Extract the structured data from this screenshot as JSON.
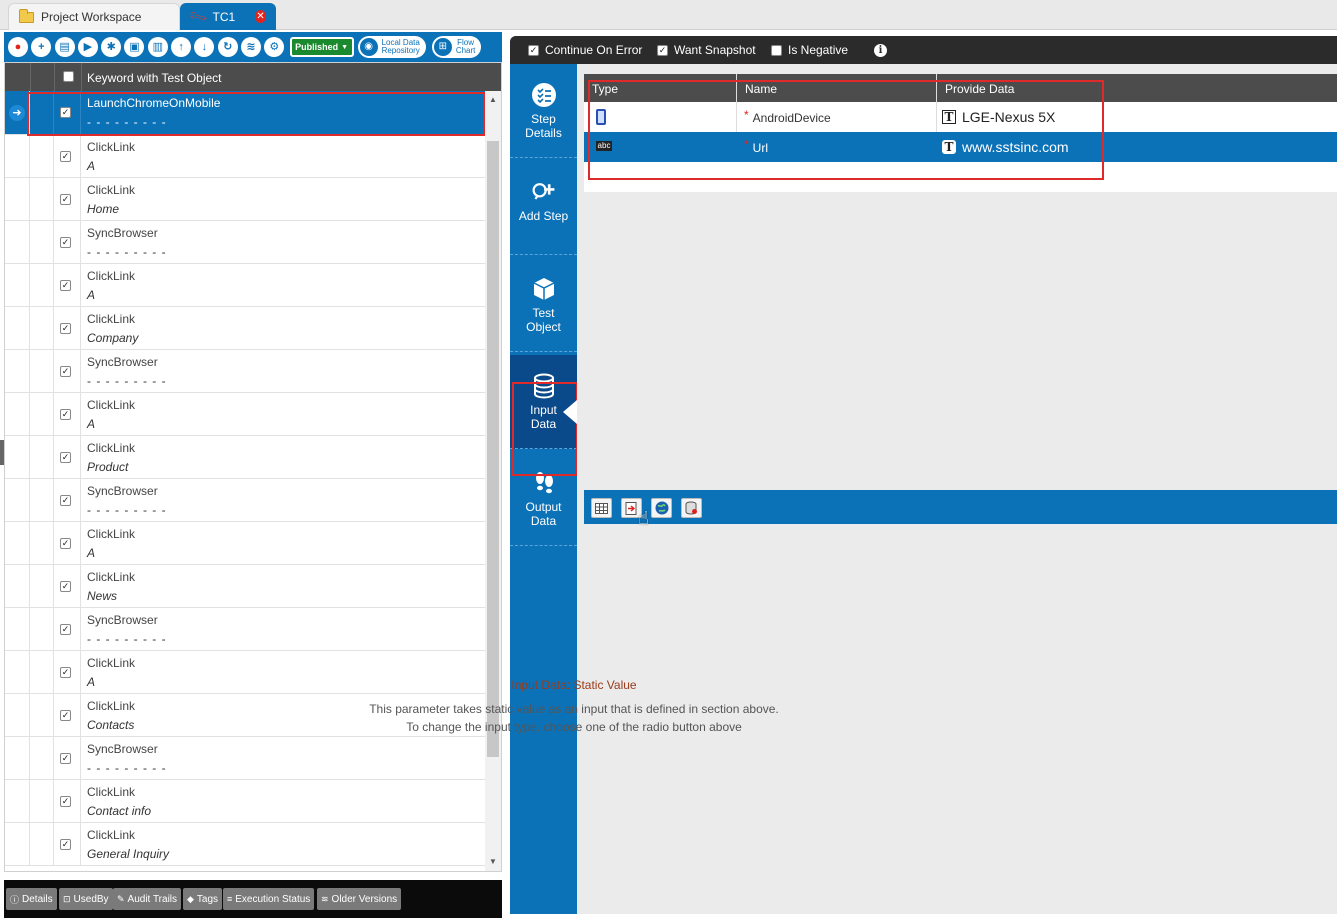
{
  "tabs": {
    "workspace": "Project Workspace",
    "testcase": "TC1"
  },
  "toolbar": {
    "published": "Published",
    "local_repo_line1": "Local Data",
    "local_repo_line2": "Repository",
    "flow_chart_line1": "Flow",
    "flow_chart_line2": "Chart"
  },
  "grid": {
    "header": "Keyword with Test Object",
    "rows": [
      {
        "keyword": "LaunchChromeOnMobile",
        "object": "- - - - - - - - -"
      },
      {
        "keyword": "ClickLink",
        "object": "A"
      },
      {
        "keyword": "ClickLink",
        "object": "Home"
      },
      {
        "keyword": "SyncBrowser",
        "object": "- - - - - - - - -"
      },
      {
        "keyword": "ClickLink",
        "object": "A"
      },
      {
        "keyword": "ClickLink",
        "object": "Company"
      },
      {
        "keyword": "SyncBrowser",
        "object": "- - - - - - - - -"
      },
      {
        "keyword": "ClickLink",
        "object": "A"
      },
      {
        "keyword": "ClickLink",
        "object": "Product"
      },
      {
        "keyword": "SyncBrowser",
        "object": "- - - - - - - - -"
      },
      {
        "keyword": "ClickLink",
        "object": "A"
      },
      {
        "keyword": "ClickLink",
        "object": "News"
      },
      {
        "keyword": "SyncBrowser",
        "object": "- - - - - - - - -"
      },
      {
        "keyword": "ClickLink",
        "object": "A"
      },
      {
        "keyword": "ClickLink",
        "object": "Contacts"
      },
      {
        "keyword": "SyncBrowser",
        "object": "- - - - - - - - -"
      },
      {
        "keyword": "ClickLink",
        "object": "Contact info"
      },
      {
        "keyword": "ClickLink",
        "object": "General Inquiry"
      }
    ]
  },
  "bottom_tabs": [
    "Details",
    "UsedBy",
    "Audit Trails",
    "Tags",
    "Execution Status",
    "Older Versions"
  ],
  "options": {
    "continue_on_error": "Continue On Error",
    "want_snapshot": "Want Snapshot",
    "is_negative": "Is Negative"
  },
  "sidenav": {
    "step_details_1": "Step",
    "step_details_2": "Details",
    "add_step": "Add Step",
    "test_object_1": "Test",
    "test_object_2": "Object",
    "input_data_1": "Input",
    "input_data_2": "Data",
    "output_data_1": "Output",
    "output_data_2": "Data"
  },
  "params": {
    "headers": {
      "type": "Type",
      "name": "Name",
      "data": "Provide Data"
    },
    "rows": [
      {
        "type_icon": "mobile-device-icon",
        "name": "AndroidDevice",
        "value": "LGE-Nexus 5X"
      },
      {
        "type_icon": "abc-string-icon",
        "type_text": "abc",
        "name": "Url",
        "value": "www.sstsinc.com"
      }
    ]
  },
  "message": {
    "title": "Input Data: Static Value",
    "line1": "This parameter takes static value as an input that is defined in section above.",
    "line2": "To change the input type, choose one of the radio button above"
  },
  "colors": {
    "accent": "#0c72b8",
    "highlight": "#e02a2a",
    "header": "#4c4c4c"
  }
}
